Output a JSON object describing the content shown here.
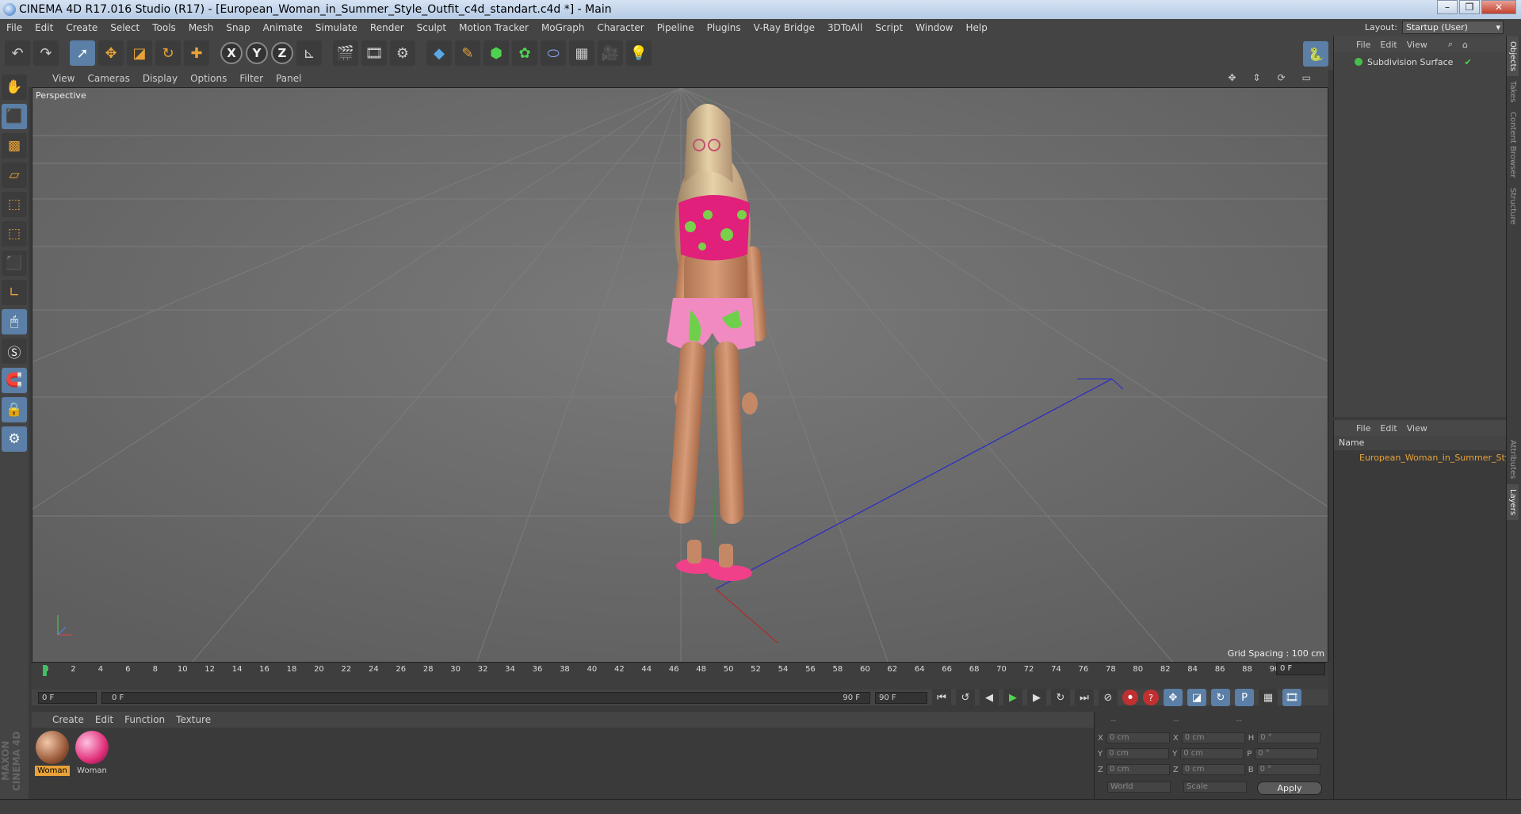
{
  "window": {
    "title": "CINEMA 4D R17.016 Studio (R17) - [European_Woman_in_Summer_Style_Outfit_c4d_standart.c4d *] - Main"
  },
  "menu": [
    "File",
    "Edit",
    "Create",
    "Select",
    "Tools",
    "Mesh",
    "Snap",
    "Animate",
    "Simulate",
    "Render",
    "Sculpt",
    "Motion Tracker",
    "MoGraph",
    "Character",
    "Pipeline",
    "Plugins",
    "V-Ray Bridge",
    "3DToAll",
    "Script",
    "Window",
    "Help"
  ],
  "layout": {
    "label": "Layout:",
    "value": "Startup (User)"
  },
  "viewport": {
    "menu": [
      "View",
      "Cameras",
      "Display",
      "Options",
      "Filter",
      "Panel"
    ],
    "camera": "Perspective",
    "grid_spacing": "Grid Spacing : 100 cm"
  },
  "timeline": {
    "ticks": [
      "0",
      "2",
      "4",
      "6",
      "8",
      "10",
      "12",
      "14",
      "16",
      "18",
      "20",
      "22",
      "24",
      "26",
      "28",
      "30",
      "32",
      "34",
      "36",
      "38",
      "40",
      "42",
      "44",
      "46",
      "48",
      "50",
      "52",
      "54",
      "56",
      "58",
      "60",
      "62",
      "64",
      "66",
      "68",
      "70",
      "72",
      "74",
      "76",
      "78",
      "80",
      "82",
      "84",
      "86",
      "88",
      "90"
    ],
    "current_frame": "0 F",
    "start_field": "0 F",
    "slider_start": "0 F",
    "slider_end": "90 F",
    "end_field": "90 F"
  },
  "materials": {
    "menu": [
      "Create",
      "Edit",
      "Function",
      "Texture"
    ],
    "items": [
      {
        "name": "Woman",
        "selected": true
      },
      {
        "name": "Woman",
        "selected": false
      }
    ]
  },
  "coords": {
    "header": [
      "--",
      "--",
      "--"
    ],
    "rows": [
      {
        "a": "X",
        "v1": "0 cm",
        "b": "X",
        "v2": "0 cm",
        "c": "H",
        "v3": "0 °"
      },
      {
        "a": "Y",
        "v1": "0 cm",
        "b": "Y",
        "v2": "0 cm",
        "c": "P",
        "v3": "0 °"
      },
      {
        "a": "Z",
        "v1": "0 cm",
        "b": "Z",
        "v2": "0 cm",
        "c": "B",
        "v3": "0 °"
      }
    ],
    "mode1": "World",
    "mode2": "Scale",
    "apply": "Apply"
  },
  "objects": {
    "menu": [
      "File",
      "Edit",
      "View"
    ],
    "items": [
      "Subdivision Surface"
    ]
  },
  "layers": {
    "menu": [
      "File",
      "Edit",
      "View"
    ],
    "column": "Name",
    "items": [
      "European_Woman_in_Summer_Sty"
    ]
  },
  "side_tabs": [
    "Objects",
    "Takes",
    "Content Browser",
    "Structure",
    "Attributes",
    "Layers"
  ],
  "brand": "MAXON CINEMA 4D",
  "colors": {
    "accent": "#e8a238",
    "active": "#5b7fa6",
    "play": "#4fd34f"
  }
}
